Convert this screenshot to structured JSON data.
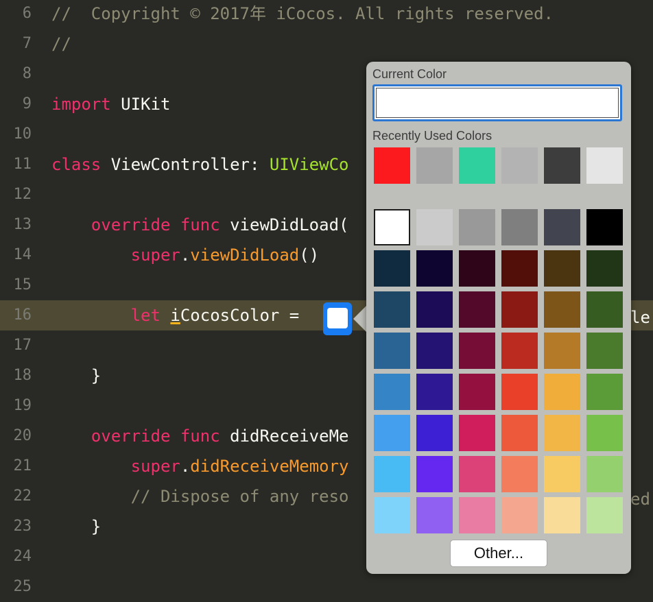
{
  "editor": {
    "lines": [
      {
        "n": "6",
        "tokens": [
          {
            "t": "//  Copyright © 2017年 iCocos. All rights reserved.",
            "c": "comment"
          }
        ]
      },
      {
        "n": "7",
        "tokens": [
          {
            "t": "//",
            "c": "comment"
          }
        ]
      },
      {
        "n": "8",
        "tokens": []
      },
      {
        "n": "9",
        "tokens": [
          {
            "t": "import",
            "c": "kw"
          },
          {
            "t": " UIKit",
            "c": ""
          }
        ]
      },
      {
        "n": "10",
        "tokens": []
      },
      {
        "n": "11",
        "tokens": [
          {
            "t": "class",
            "c": "kw"
          },
          {
            "t": " ViewController: ",
            "c": ""
          },
          {
            "t": "UIViewCo",
            "c": "type"
          }
        ]
      },
      {
        "n": "12",
        "tokens": []
      },
      {
        "n": "13",
        "tokens": [
          {
            "t": "    override",
            "c": "kw"
          },
          {
            "t": " ",
            "c": ""
          },
          {
            "t": "func",
            "c": "kw"
          },
          {
            "t": " viewDidLoad(",
            "c": ""
          }
        ]
      },
      {
        "n": "14",
        "tokens": [
          {
            "t": "        super",
            "c": "kw"
          },
          {
            "t": ".",
            "c": ""
          },
          {
            "t": "viewDidLoad",
            "c": "call"
          },
          {
            "t": "()",
            "c": ""
          }
        ]
      },
      {
        "n": "15",
        "tokens": []
      },
      {
        "n": "16",
        "tokens": [
          {
            "t": "        let",
            "c": "kw"
          },
          {
            "t": " ",
            "c": ""
          },
          {
            "t": "i",
            "c": "underscore"
          },
          {
            "t": "CocosColor = ",
            "c": ""
          }
        ],
        "current": true
      },
      {
        "n": "17",
        "tokens": []
      },
      {
        "n": "18",
        "tokens": [
          {
            "t": "    }",
            "c": ""
          }
        ]
      },
      {
        "n": "19",
        "tokens": []
      },
      {
        "n": "20",
        "tokens": [
          {
            "t": "    override",
            "c": "kw"
          },
          {
            "t": " ",
            "c": ""
          },
          {
            "t": "func",
            "c": "kw"
          },
          {
            "t": " didReceiveMe",
            "c": ""
          }
        ]
      },
      {
        "n": "21",
        "tokens": [
          {
            "t": "        super",
            "c": "kw"
          },
          {
            "t": ".",
            "c": ""
          },
          {
            "t": "didReceiveMemory",
            "c": "call"
          }
        ]
      },
      {
        "n": "22",
        "tokens": [
          {
            "t": "        // Dispose of any reso",
            "c": "comment"
          }
        ]
      },
      {
        "n": "23",
        "tokens": [
          {
            "t": "    }",
            "c": ""
          }
        ]
      },
      {
        "n": "24",
        "tokens": []
      },
      {
        "n": "25",
        "tokens": []
      }
    ],
    "line16_trailing": "le",
    "line22_trailing": "ed"
  },
  "color_picker": {
    "current_color_label": "Current Color",
    "current_color": "#ffffff",
    "recent_label": "Recently Used Colors",
    "recent_colors": [
      "#fd1a1f",
      "#a6a6a6",
      "#2fcf9e",
      "#b3b3b3",
      "#3d3d3d",
      "#e5e5e5"
    ],
    "palette": [
      [
        "#ffffff",
        "#cbcbcb",
        "#999999",
        "#7f7f7f",
        "#424550",
        "#000000"
      ],
      [
        "#102a40",
        "#0e0530",
        "#2e0519",
        "#520f0a",
        "#4a3510",
        "#213616"
      ],
      [
        "#1e4766",
        "#1c0b56",
        "#53092a",
        "#8b1a14",
        "#7e5519",
        "#365c22"
      ],
      [
        "#2a6494",
        "#251374",
        "#760d37",
        "#bb2b20",
        "#b47a27",
        "#4a7a2c"
      ],
      [
        "#3584c6",
        "#2f1893",
        "#94103f",
        "#e84029",
        "#f1ad3a",
        "#5b9b38"
      ],
      [
        "#44a0ef",
        "#3d20d4",
        "#d01e5c",
        "#ed5a3b",
        "#f2b646",
        "#77c14b"
      ],
      [
        "#48baf4",
        "#6428f1",
        "#dc4277",
        "#f27c5c",
        "#f7ca62",
        "#95d06e"
      ],
      [
        "#7dd3f9",
        "#9060f2",
        "#e87ca3",
        "#f4a68e",
        "#f9dc98",
        "#bce49c"
      ]
    ],
    "selected_palette_color": "#ffffff",
    "other_button_label": "Other..."
  }
}
